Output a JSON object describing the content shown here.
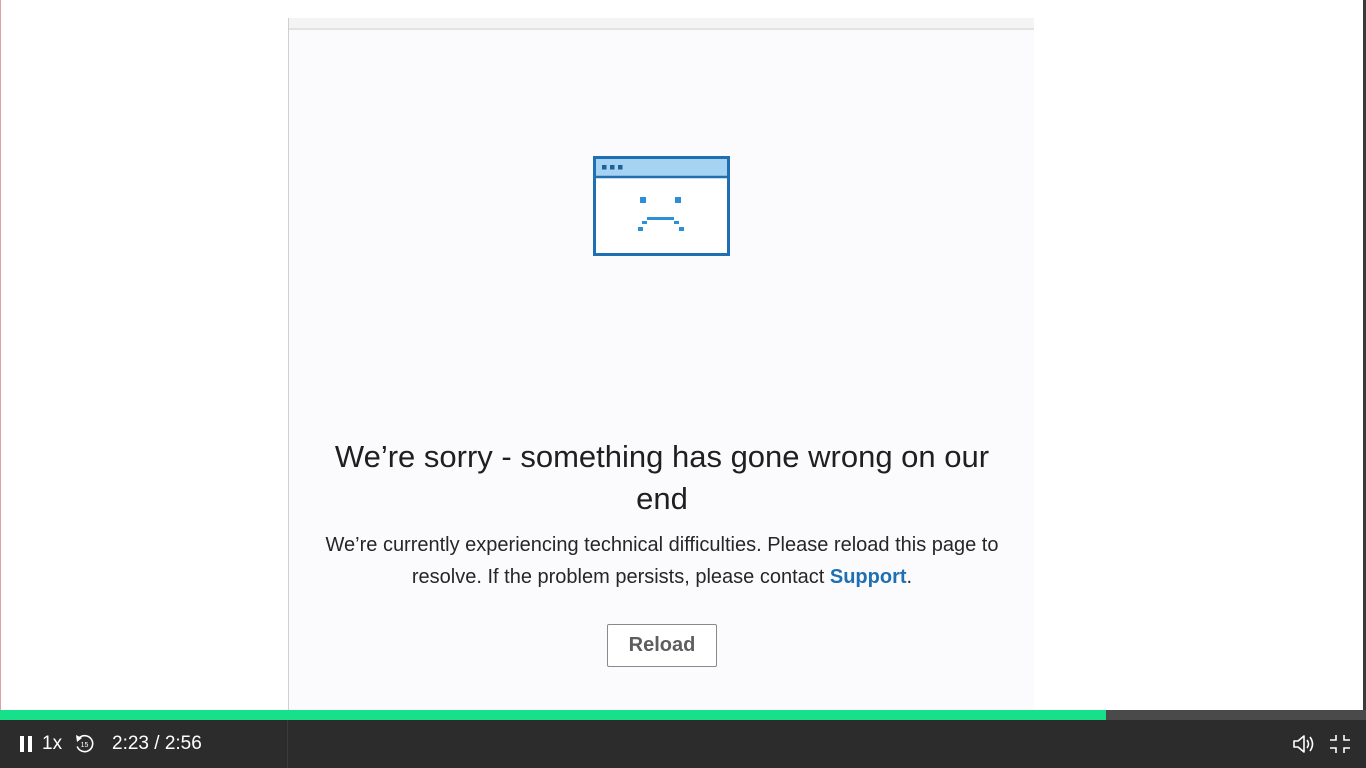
{
  "error_page": {
    "title": "We’re sorry - something has gone wrong on our end",
    "message_before_link": "We’re currently experiencing technical difficulties. Please reload this page to resolve. If the problem persists, please contact ",
    "link_label": "Support",
    "message_after_link": ".",
    "reload_label": "Reload",
    "illustration_icon": "sad-browser-window-icon",
    "accent_color": "#1f6fb2"
  },
  "player": {
    "progress_fraction": 0.81,
    "progress_color": "#17e08a",
    "speed_label": "1x",
    "current_time": "2:23",
    "time_separator": " / ",
    "duration": "2:56",
    "icons": {
      "pause": "pause-icon",
      "rewind": "rewind-15-icon",
      "volume": "volume-icon",
      "exit_fullscreen": "exit-fullscreen-icon"
    }
  }
}
